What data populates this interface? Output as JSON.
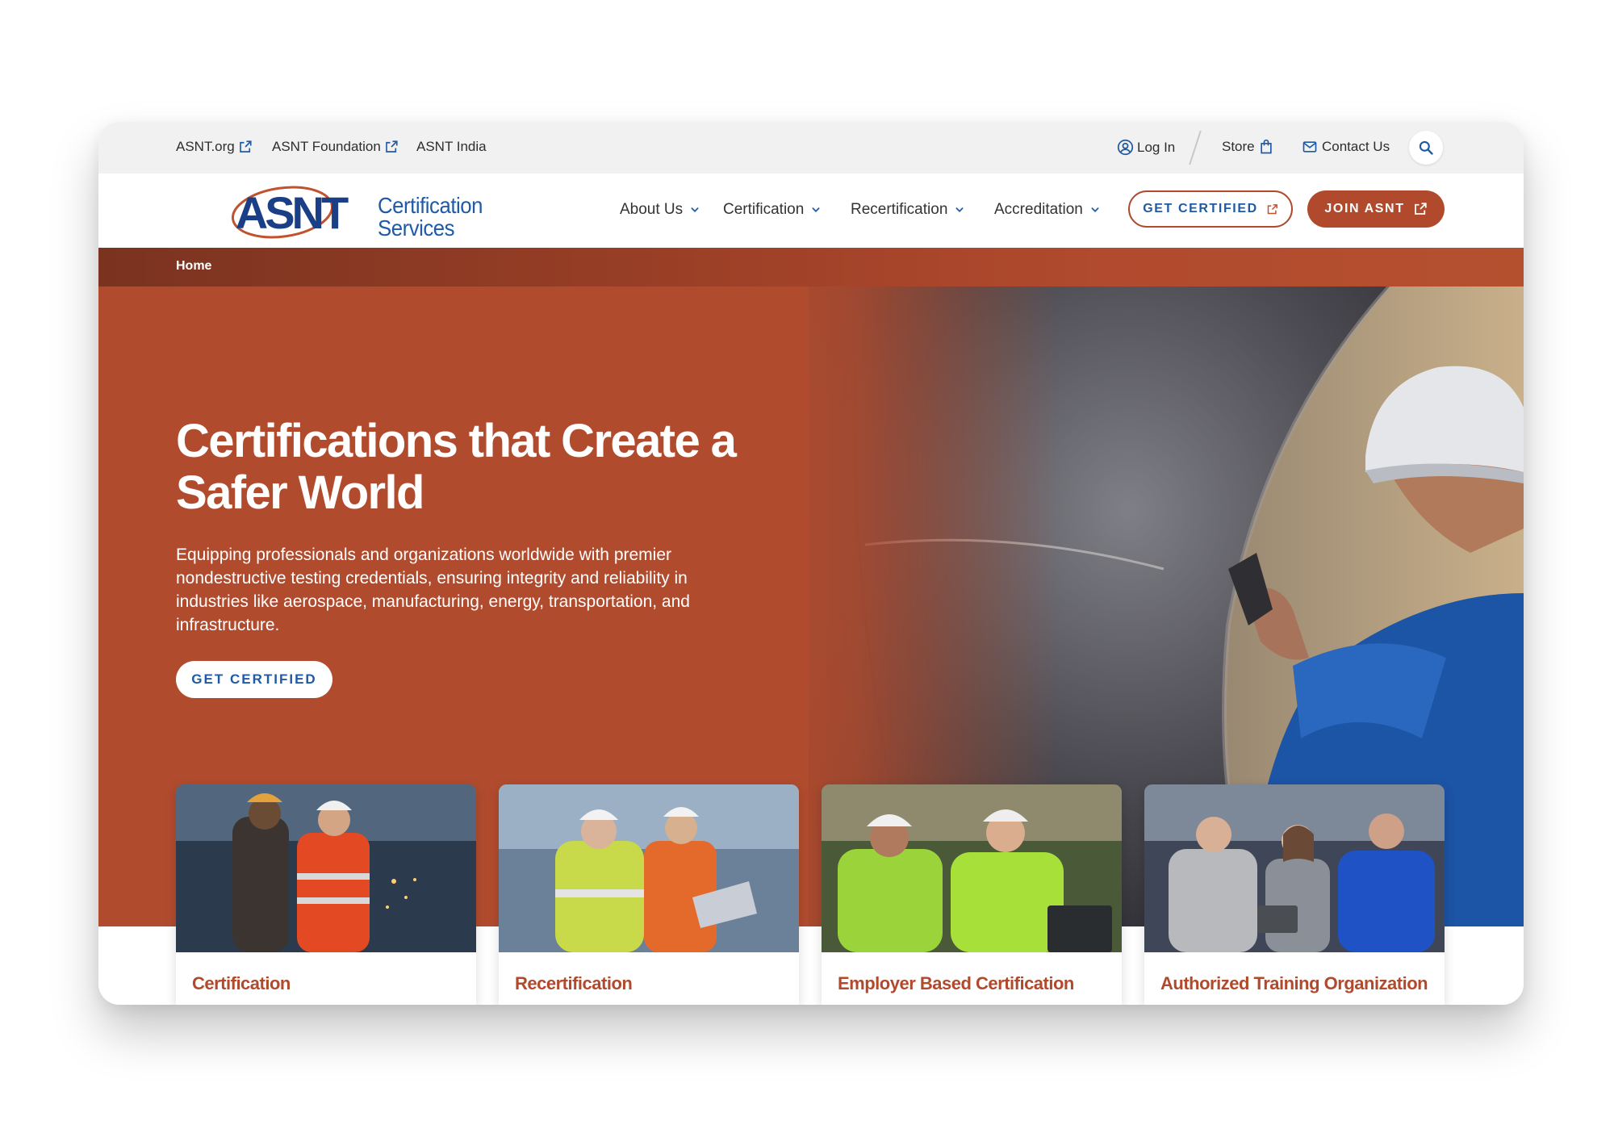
{
  "utility_bar": {
    "links": [
      {
        "label": "ASNT.org",
        "icon": "external-link-icon"
      },
      {
        "label": "ASNT Foundation",
        "icon": "external-link-icon"
      },
      {
        "label": "ASNT India"
      }
    ],
    "login_label": "Log In",
    "store_label": "Store",
    "contact_label": "Contact Us",
    "icons": {
      "login": "user-circle-icon",
      "store": "shopping-bag-icon",
      "contact": "envelope-icon",
      "search": "search-icon"
    }
  },
  "logo": {
    "mark": "ASNT",
    "line1": "Certification",
    "line2": "Services"
  },
  "nav": {
    "items": [
      {
        "label": "About Us"
      },
      {
        "label": "Certification"
      },
      {
        "label": "Recertification"
      },
      {
        "label": "Accreditation"
      }
    ],
    "get_certified_label": "GET CERTIFIED",
    "join_label": "JOIN ASNT"
  },
  "breadcrumb": {
    "home": "Home"
  },
  "hero": {
    "title_line1": "Certifications that Create a",
    "title_line2": "Safer World",
    "body": "Equipping professionals and organizations worldwide with premier nondestructive testing credentials, ensuring integrity and reliability in industries like aerospace, manufacturing, energy, transportation, and infrastructure.",
    "cta_label": "GET CERTIFIED"
  },
  "cards": [
    {
      "title": "Certification"
    },
    {
      "title": "Recertification"
    },
    {
      "title": "Employer Based Certification"
    },
    {
      "title": "Authorized Training Organization"
    }
  ],
  "colors": {
    "brand_orange": "#b14a2c",
    "brand_blue": "#1f5aa6",
    "utility_bg": "#f1f1f1"
  }
}
